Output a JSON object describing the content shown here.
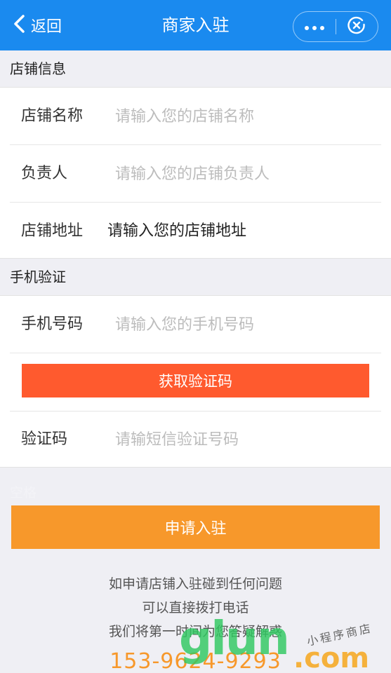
{
  "navbar": {
    "back_label": "返回",
    "title": "商家入驻"
  },
  "shop_section": {
    "title": "店铺信息",
    "fields": [
      {
        "label": "店铺名称",
        "placeholder": "请输入您的店铺名称"
      },
      {
        "label": "负责人",
        "placeholder": "请输入您的店铺负责人"
      },
      {
        "label": "店铺地址",
        "value": "请输入您的店铺地址"
      }
    ]
  },
  "phone_section": {
    "title": "手机验证",
    "phone_field": {
      "label": "手机号码",
      "placeholder": "请输入您的手机号码"
    },
    "get_code_label": "获取验证码",
    "code_field": {
      "label": "验证码",
      "placeholder": "请输短信验证号码"
    }
  },
  "blank_label": "空格",
  "apply_label": "申请入驻",
  "tips": [
    "如申请店铺入驻碰到任何问题",
    "可以直接拨打电话",
    "我们将第一时间为您答疑解惑"
  ],
  "phone_number": "153-9624-9293",
  "watermark": {
    "main": "glun",
    "com": ".com",
    "small": "小程序商店"
  },
  "colors": {
    "navbar": "#1a8aef",
    "get_code_button": "#ff5a2e",
    "apply_button": "#f7982b",
    "phone_text": "#f7982b"
  },
  "icons": {
    "back": "chevron-left-icon",
    "more": "more-dots-icon",
    "close": "close-circle-icon"
  }
}
